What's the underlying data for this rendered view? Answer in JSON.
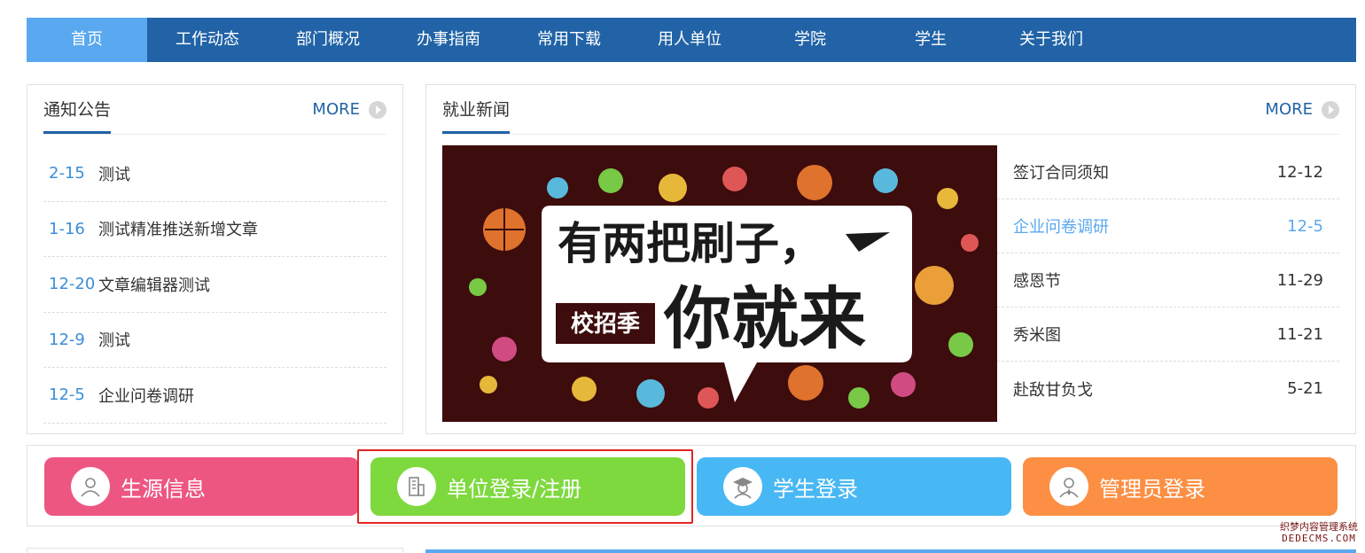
{
  "nav": {
    "items": [
      {
        "label": "首页"
      },
      {
        "label": "工作动态"
      },
      {
        "label": "部门概况"
      },
      {
        "label": "办事指南"
      },
      {
        "label": "常用下载"
      },
      {
        "label": "用人单位"
      },
      {
        "label": "学院"
      },
      {
        "label": "学生"
      },
      {
        "label": "关于我们"
      }
    ],
    "active_index": 0
  },
  "notices": {
    "title": "通知公告",
    "more_label": "MORE",
    "items": [
      {
        "date": "2-15",
        "title": "测试"
      },
      {
        "date": "1-16",
        "title": "测试精准推送新增文章"
      },
      {
        "date": "12-20",
        "title": "文章编辑器测试"
      },
      {
        "date": "12-9",
        "title": "测试"
      },
      {
        "date": "12-5",
        "title": "企业问卷调研"
      }
    ]
  },
  "news": {
    "title": "就业新闻",
    "more_label": "MORE",
    "banner": {
      "headline": "有两把刷子，",
      "tag": "校招季",
      "slogan": "你就来"
    },
    "items": [
      {
        "title": "签订合同须知",
        "date": "12-12"
      },
      {
        "title": "企业问卷调研",
        "date": "12-5"
      },
      {
        "title": "感恩节",
        "date": "11-29"
      },
      {
        "title": "秀米图",
        "date": "11-21"
      },
      {
        "title": "赴敌甘负戈",
        "date": "5-21"
      }
    ]
  },
  "quick_buttons": [
    {
      "label": "生源信息",
      "icon": "person-icon",
      "color": "#ee5682"
    },
    {
      "label": "单位登录/注册",
      "icon": "building-icon",
      "color": "#7ed93f"
    },
    {
      "label": "学生登录",
      "icon": "graduate-icon",
      "color": "#48b8f4"
    },
    {
      "label": "管理员登录",
      "icon": "admin-icon",
      "color": "#fc8f44"
    }
  ],
  "watermark": {
    "line1": "织梦内容管理系统",
    "line2": "DEDECMS.COM"
  },
  "colors": {
    "nav_bg": "#2163a6",
    "nav_active": "#5aa8ef",
    "date_blue": "#3b8ed8",
    "highlight": "#5aa8ef",
    "selection": "#e32424"
  }
}
